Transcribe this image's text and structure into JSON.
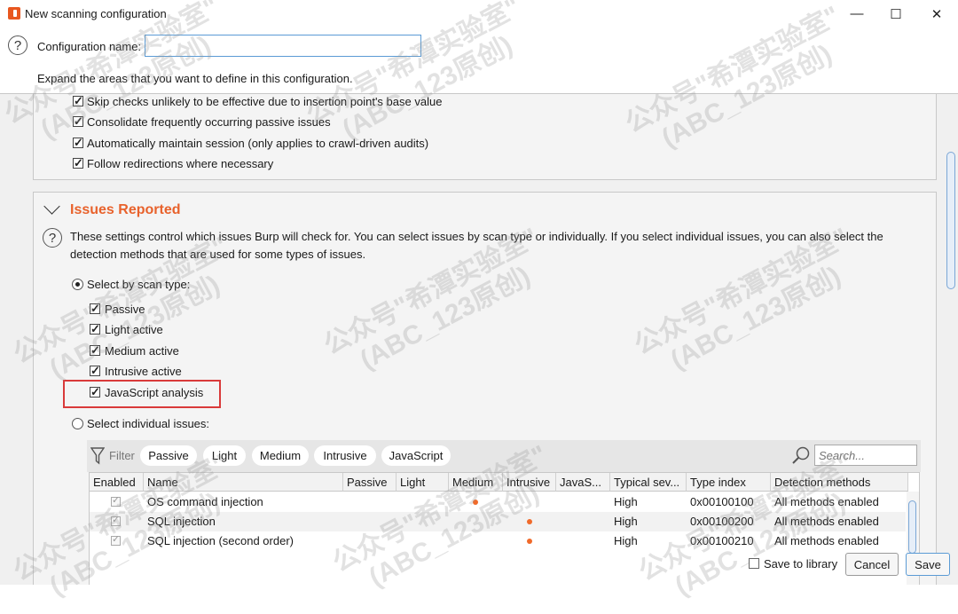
{
  "window": {
    "title": "New scanning configuration",
    "icon": "burp-icon",
    "controls": {
      "minimize": "—",
      "maximize": "☐",
      "close": "✕"
    }
  },
  "header": {
    "config_name_label": "Configuration name:",
    "config_name_value": "",
    "expand_text": "Expand the areas that you want to define in this configuration."
  },
  "audit_options": {
    "items": [
      {
        "label": "Skip checks unlikely to be effective due to insertion point's base value",
        "checked": true
      },
      {
        "label": "Consolidate frequently occurring passive issues",
        "checked": true
      },
      {
        "label": "Automatically maintain session (only applies to crawl-driven audits)",
        "checked": true
      },
      {
        "label": "Follow redirections where necessary",
        "checked": true
      }
    ]
  },
  "issues_reported": {
    "title": "Issues Reported",
    "description": "These settings control which issues Burp will check for. You can select issues by scan type or individually. If you select individual issues, you can also select the detection methods that are used for some types of issues.",
    "by_scan_type_label": "Select by scan type:",
    "scan_types": [
      {
        "label": "Passive",
        "checked": true
      },
      {
        "label": "Light active",
        "checked": true
      },
      {
        "label": "Medium active",
        "checked": true
      },
      {
        "label": "Intrusive active",
        "checked": true
      },
      {
        "label": "JavaScript analysis",
        "checked": true
      }
    ],
    "individual_label": "Select individual issues:",
    "filter": {
      "label": "Filter",
      "pills": [
        "Passive",
        "Light",
        "Medium",
        "Intrusive",
        "JavaScript"
      ],
      "search_placeholder": "Search..."
    },
    "table": {
      "columns": [
        "Enabled",
        "Name",
        "Passive",
        "Light",
        "Medium",
        "Intrusive",
        "JavaS...",
        "Typical sev...",
        "Type index",
        "Detection methods"
      ],
      "rows": [
        {
          "name": "OS command injection",
          "dot_column": "Medium",
          "severity": "High",
          "type_index": "0x00100100",
          "detection": "All methods enabled"
        },
        {
          "name": "SQL injection",
          "dot_column": "Intrusive",
          "severity": "High",
          "type_index": "0x00100200",
          "detection": "All methods enabled"
        },
        {
          "name": "SQL injection (second order)",
          "dot_column": "Intrusive",
          "severity": "High",
          "type_index": "0x00100210",
          "detection": "All methods enabled"
        }
      ]
    }
  },
  "footer": {
    "save_to_library_label": "Save to library",
    "cancel_label": "Cancel",
    "save_label": "Save"
  },
  "watermark": {
    "line1": "公众号\"希潭实验室\"",
    "line2": "(ABC_123原创)"
  },
  "colors": {
    "accent_orange": "#e8622c",
    "highlight_red": "#d93a3a",
    "input_border": "#5b9bd5"
  }
}
